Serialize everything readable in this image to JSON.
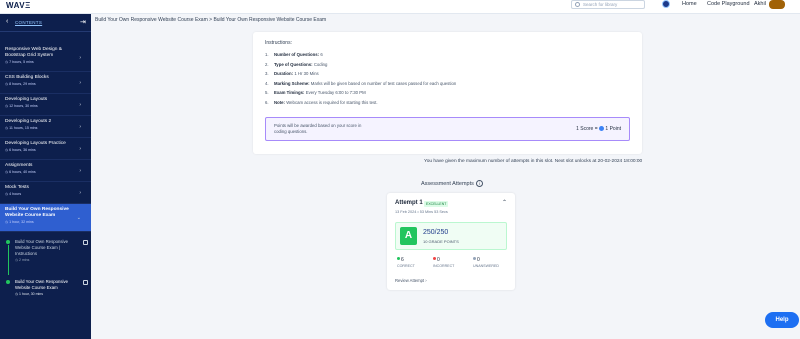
{
  "topbar": {
    "logo": "WAVΞ",
    "search_placeholder": "Search for library",
    "links": [
      "Home",
      "Code Playground",
      "Akhil"
    ]
  },
  "sidebar": {
    "back": "‹",
    "title": "CONTENTS",
    "collapse": "⇥",
    "items": [
      {
        "label": "Responsive Web Design & Bootstrap Grid System",
        "meta": "◷ 7 hours, 5 mins"
      },
      {
        "label": "CSS Building Blocks",
        "meta": "◷ 8 hours, 29 mins"
      },
      {
        "label": "Developing Layouts",
        "meta": "◷ 12 hours, 30 mins"
      },
      {
        "label": "Developing Layouts 2",
        "meta": "◷ 11 hours, 15 mins"
      },
      {
        "label": "Developing Layouts Practice",
        "meta": "◷ 6 hours, 36 mins"
      },
      {
        "label": "Assignments",
        "meta": "◷ 6 hours, 40 mins"
      },
      {
        "label": "Mock Tests",
        "meta": "◷ 4 hours"
      },
      {
        "label": "Build Your Own Responsive Website Course Exam",
        "meta": "◷ 1 hour, 32 mins"
      }
    ],
    "sub_items": [
      {
        "label": "Build Your Own Responsive Website Course Exam | Instructions",
        "meta": "◷ 2 mins"
      },
      {
        "label": "Build Your Own Responsive Website Course Exam",
        "meta": "◷ 1 hour, 30 mins"
      }
    ]
  },
  "breadcrumb": "Build Your Own Responsive Website Course Exam > Build Your Own Responsive Website Course Exam",
  "instructions": {
    "title": "Instructions:",
    "rows": [
      {
        "n": "1.",
        "k": "Number of Questions:",
        "v": "6"
      },
      {
        "n": "2.",
        "k": "Type of Questions:",
        "v": "Coding"
      },
      {
        "n": "3.",
        "k": "Duration:",
        "v": "1 Hr 30 Mins"
      },
      {
        "n": "4.",
        "k": "Marking Scheme:",
        "v": "Marks will be given based on number of test cases passed for each question"
      },
      {
        "n": "5.",
        "k": "Exam Timings:",
        "v": "Every Tuesday 6:00 to 7:30 PM"
      },
      {
        "n": "6.",
        "k": "Note:",
        "v": "Webcam access is required for starting this test."
      }
    ],
    "points_text": "Points will be awarded based on your score in coding questions.",
    "points_rule": "1 Score = ",
    "points_rule_end": " 1 Point"
  },
  "attempts_note": "You have given the maximum number of attempts in this slot. Next slot unlocks at 20-02-2024 18:00:00",
  "attempts": {
    "title": "Assessment Attempts",
    "info": "i",
    "card": {
      "title": "Attempt 1",
      "badge": "EXCELLENT",
      "chevron": "⌃",
      "subtitle": "13 Feb 2024 • 53 Mins 53 Secs",
      "grade": "A",
      "score": "250/250",
      "grade_points": "10 GRADE POINTS",
      "stats": [
        {
          "value": "6",
          "label": "CORRECT",
          "color": "#22c55e"
        },
        {
          "value": "0",
          "label": "INCORRECT",
          "color": "#ef4444"
        },
        {
          "value": "0",
          "label": "UNANSWERED",
          "color": "#94a3b8"
        }
      ],
      "review": "Review Attempt ›"
    }
  },
  "help": "Help"
}
